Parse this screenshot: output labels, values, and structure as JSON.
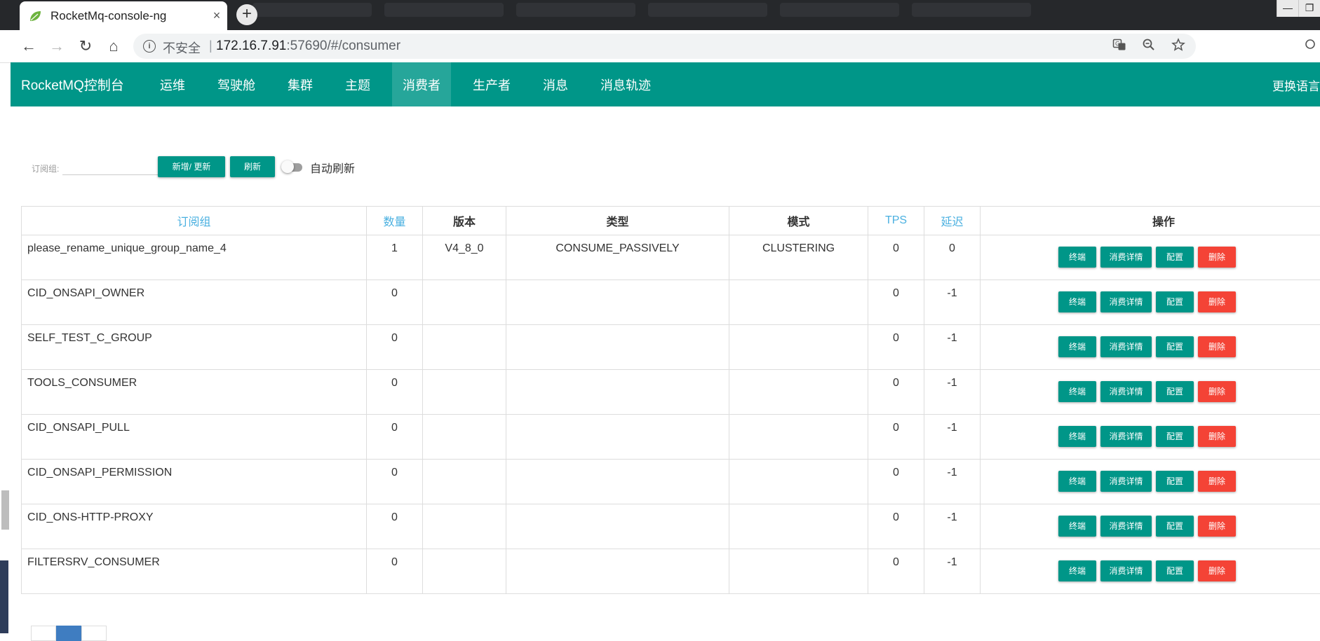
{
  "browser": {
    "tab_title": "RocketMq-console-ng",
    "new_tab": "+",
    "close_tab": "×",
    "window_controls": [
      "—",
      "❐"
    ],
    "security_label": "不安全",
    "url_host": "172.16.7.91",
    "url_rest": ":57690/#/consumer",
    "nav": {
      "back": "←",
      "forward": "→",
      "reload": "↻",
      "home": "⌂"
    },
    "icons": [
      "translate-icon",
      "zoom-icon",
      "star-icon"
    ]
  },
  "navbar": {
    "brand": "RocketMQ控制台",
    "items": [
      "运维",
      "驾驶舱",
      "集群",
      "主题",
      "消费者",
      "生产者",
      "消息",
      "消息轨迹"
    ],
    "active": "消费者",
    "language": "更换语言"
  },
  "form": {
    "group_label": "订阅组:",
    "group_value": "",
    "add_update_label": "新增/ 更新",
    "refresh_label": "刷新",
    "auto_refresh_label": "自动刷新",
    "auto_refresh_on": false
  },
  "table": {
    "headers": {
      "group": "订阅组",
      "count": "数量",
      "version": "版本",
      "type": "类型",
      "mode": "模式",
      "tps": "TPS",
      "delay": "延迟",
      "ops": "操作"
    },
    "op_labels": {
      "client": "终端",
      "consume_detail": "消费详情",
      "config": "配置",
      "delete": "删除"
    },
    "rows": [
      {
        "group": "please_rename_unique_group_name_4",
        "count": "1",
        "version": "V4_8_0",
        "type": "CONSUME_PASSIVELY",
        "mode": "CLUSTERING",
        "tps": "0",
        "delay": "0"
      },
      {
        "group": "CID_ONSAPI_OWNER",
        "count": "0",
        "version": "",
        "type": "",
        "mode": "",
        "tps": "0",
        "delay": "-1"
      },
      {
        "group": "SELF_TEST_C_GROUP",
        "count": "0",
        "version": "",
        "type": "",
        "mode": "",
        "tps": "0",
        "delay": "-1"
      },
      {
        "group": "TOOLS_CONSUMER",
        "count": "0",
        "version": "",
        "type": "",
        "mode": "",
        "tps": "0",
        "delay": "-1"
      },
      {
        "group": "CID_ONSAPI_PULL",
        "count": "0",
        "version": "",
        "type": "",
        "mode": "",
        "tps": "0",
        "delay": "-1"
      },
      {
        "group": "CID_ONSAPI_PERMISSION",
        "count": "0",
        "version": "",
        "type": "",
        "mode": "",
        "tps": "0",
        "delay": "-1"
      },
      {
        "group": "CID_ONS-HTTP-PROXY",
        "count": "0",
        "version": "",
        "type": "",
        "mode": "",
        "tps": "0",
        "delay": "-1"
      },
      {
        "group": "FILTERSRV_CONSUMER",
        "count": "0",
        "version": "",
        "type": "",
        "mode": "",
        "tps": "0",
        "delay": "-1"
      }
    ]
  },
  "colors": {
    "primary": "#009688",
    "danger": "#f44336",
    "header_link": "#4ab0e0"
  }
}
